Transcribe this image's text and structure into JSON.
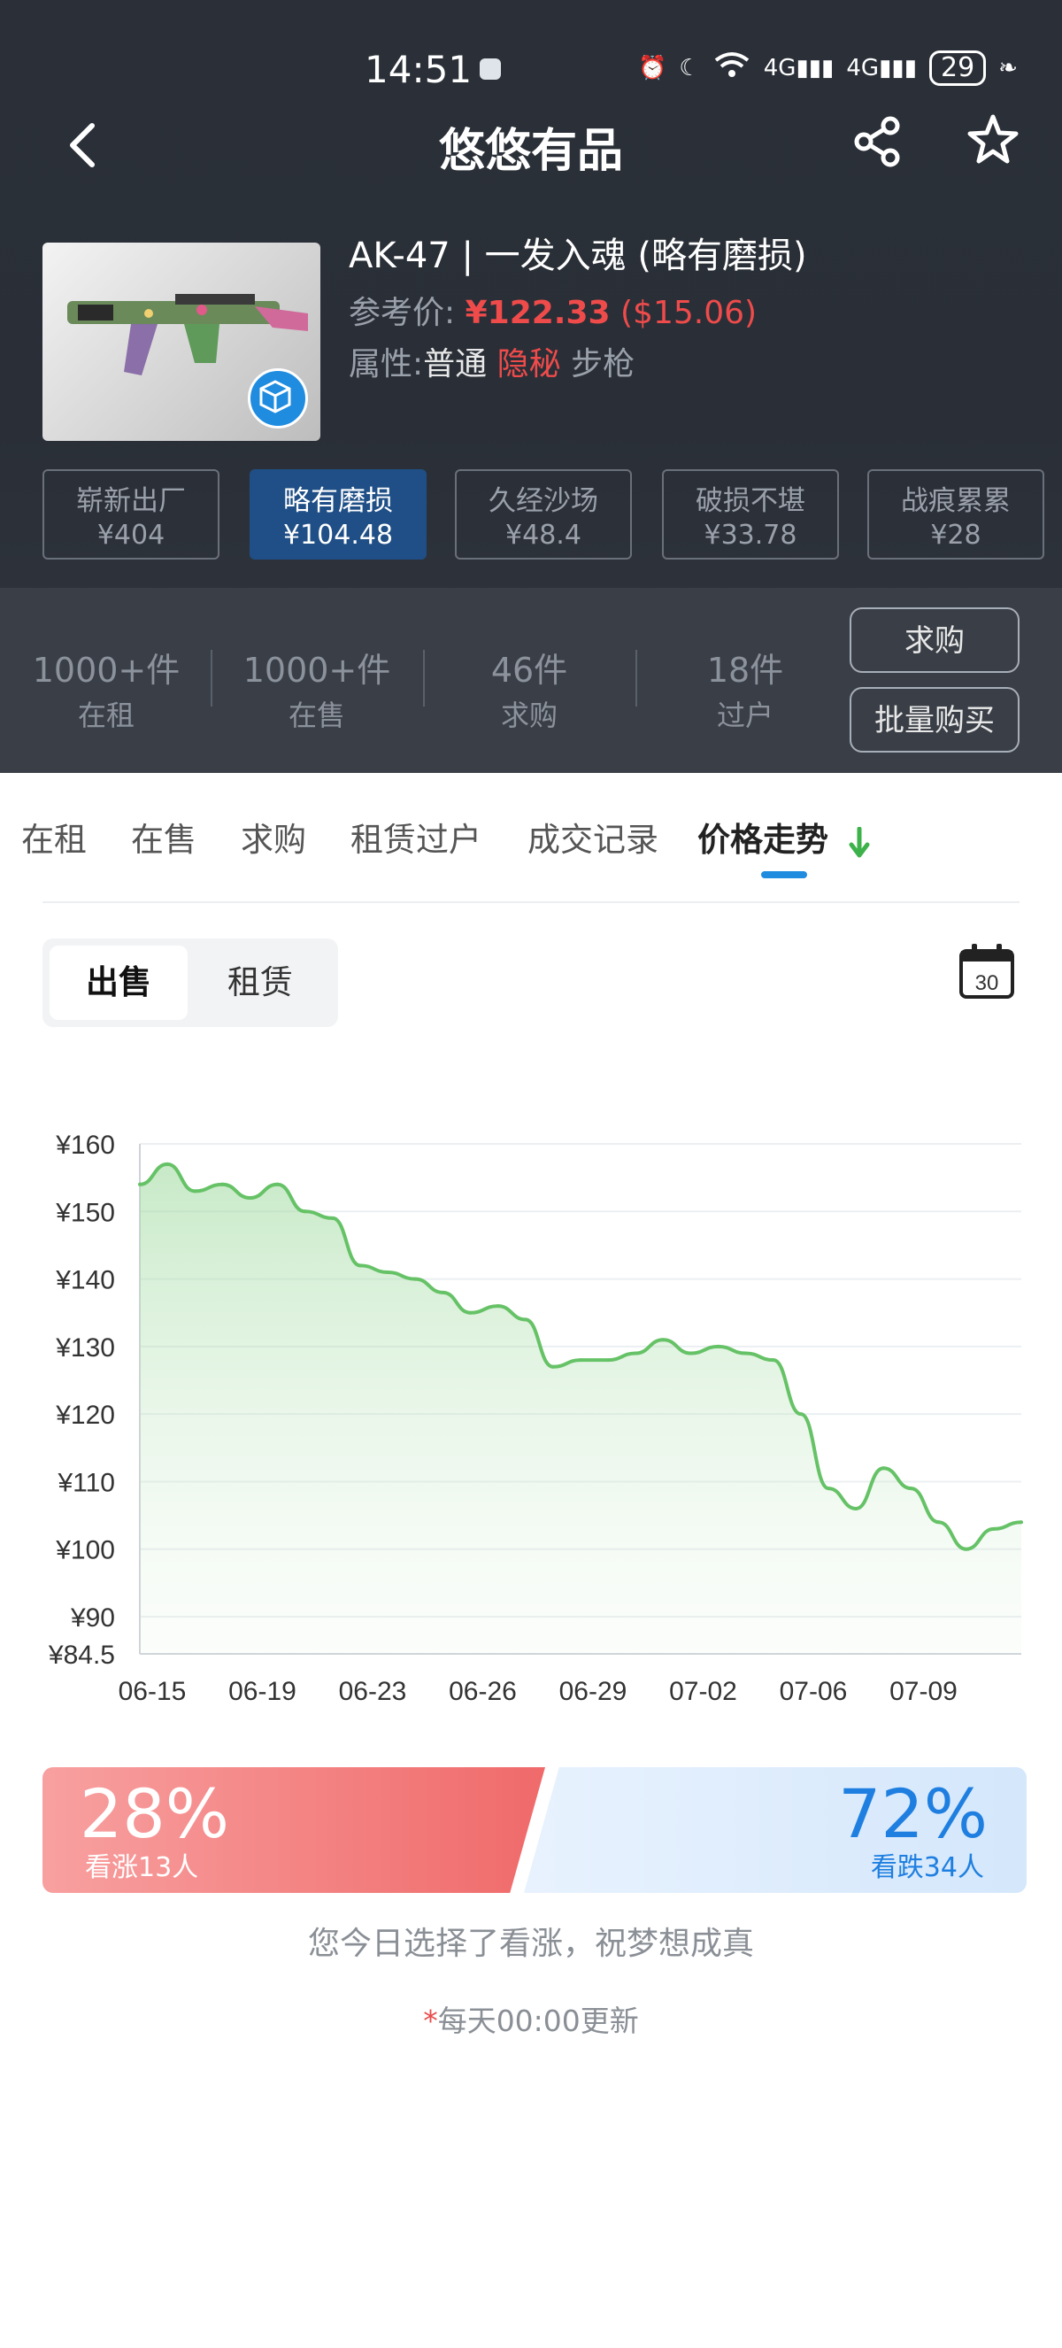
{
  "status_bar": {
    "time": "14:51",
    "net1": "4G",
    "net2": "4G",
    "battery": "29"
  },
  "nav": {
    "title": "悠悠有品"
  },
  "item": {
    "name": "AK-47 | 一发入魂 (略有磨损)",
    "ref_label": "参考价:",
    "price": "¥122.33",
    "usd": "($15.06)",
    "attr_label": "属性:",
    "attr_quality": "普通",
    "attr_rarity": "隐秘",
    "attr_type": "步枪"
  },
  "wear_options": [
    {
      "name": "崭新出厂",
      "price": "¥404"
    },
    {
      "name": "略有磨损",
      "price": "¥104.48"
    },
    {
      "name": "久经沙场",
      "price": "¥48.4"
    },
    {
      "name": "破损不堪",
      "price": "¥33.78"
    },
    {
      "name": "战痕累累",
      "price": "¥28"
    }
  ],
  "stats": [
    {
      "count": "1000+件",
      "label": "在租"
    },
    {
      "count": "1000+件",
      "label": "在售"
    },
    {
      "count": "46件",
      "label": "求购"
    },
    {
      "count": "18件",
      "label": "过户"
    }
  ],
  "buttons": {
    "buy_request": "求购",
    "bulk_buy": "批量购买"
  },
  "tabs": [
    "在租",
    "在售",
    "求购",
    "租赁过户",
    "成交记录",
    "价格走势"
  ],
  "segment": {
    "sell": "出售",
    "rent": "租赁"
  },
  "calendar": {
    "day": "30"
  },
  "colors": {
    "accent": "#1f8ce0",
    "line": "#66c266",
    "up": "#f06a6a",
    "down": "#1f7fe0"
  },
  "chart_data": {
    "type": "area",
    "y_tick_labels": [
      "¥160",
      "¥150",
      "¥140",
      "¥130",
      "¥120",
      "¥110",
      "¥100",
      "¥90",
      "¥84.5"
    ],
    "y_ticks": [
      160,
      150,
      140,
      130,
      120,
      110,
      100,
      90,
      84.5
    ],
    "ylim": [
      84.5,
      160
    ],
    "x_tick_labels": [
      "06-15",
      "06-19",
      "06-23",
      "06-26",
      "06-29",
      "07-02",
      "07-06",
      "07-09"
    ],
    "x_tick_index": [
      0,
      4,
      8,
      12,
      16,
      20,
      24,
      28
    ],
    "x_count": 33,
    "grid": true,
    "series": [
      {
        "values": [
          154,
          157,
          153,
          154,
          152,
          154,
          150,
          149,
          142,
          141,
          140,
          138,
          135,
          136,
          134,
          127,
          128,
          128,
          129,
          131,
          129,
          130,
          129,
          128,
          120,
          109,
          106,
          112,
          109,
          104,
          100,
          103,
          104
        ]
      }
    ]
  },
  "vote": {
    "up_pct": "28%",
    "up_label": "看涨13人",
    "down_pct": "72%",
    "down_label": "看跌34人"
  },
  "message": "您今日选择了看涨，祝梦想成真",
  "update_note": {
    "asterisk": "*",
    "text": "每天00:00更新"
  }
}
